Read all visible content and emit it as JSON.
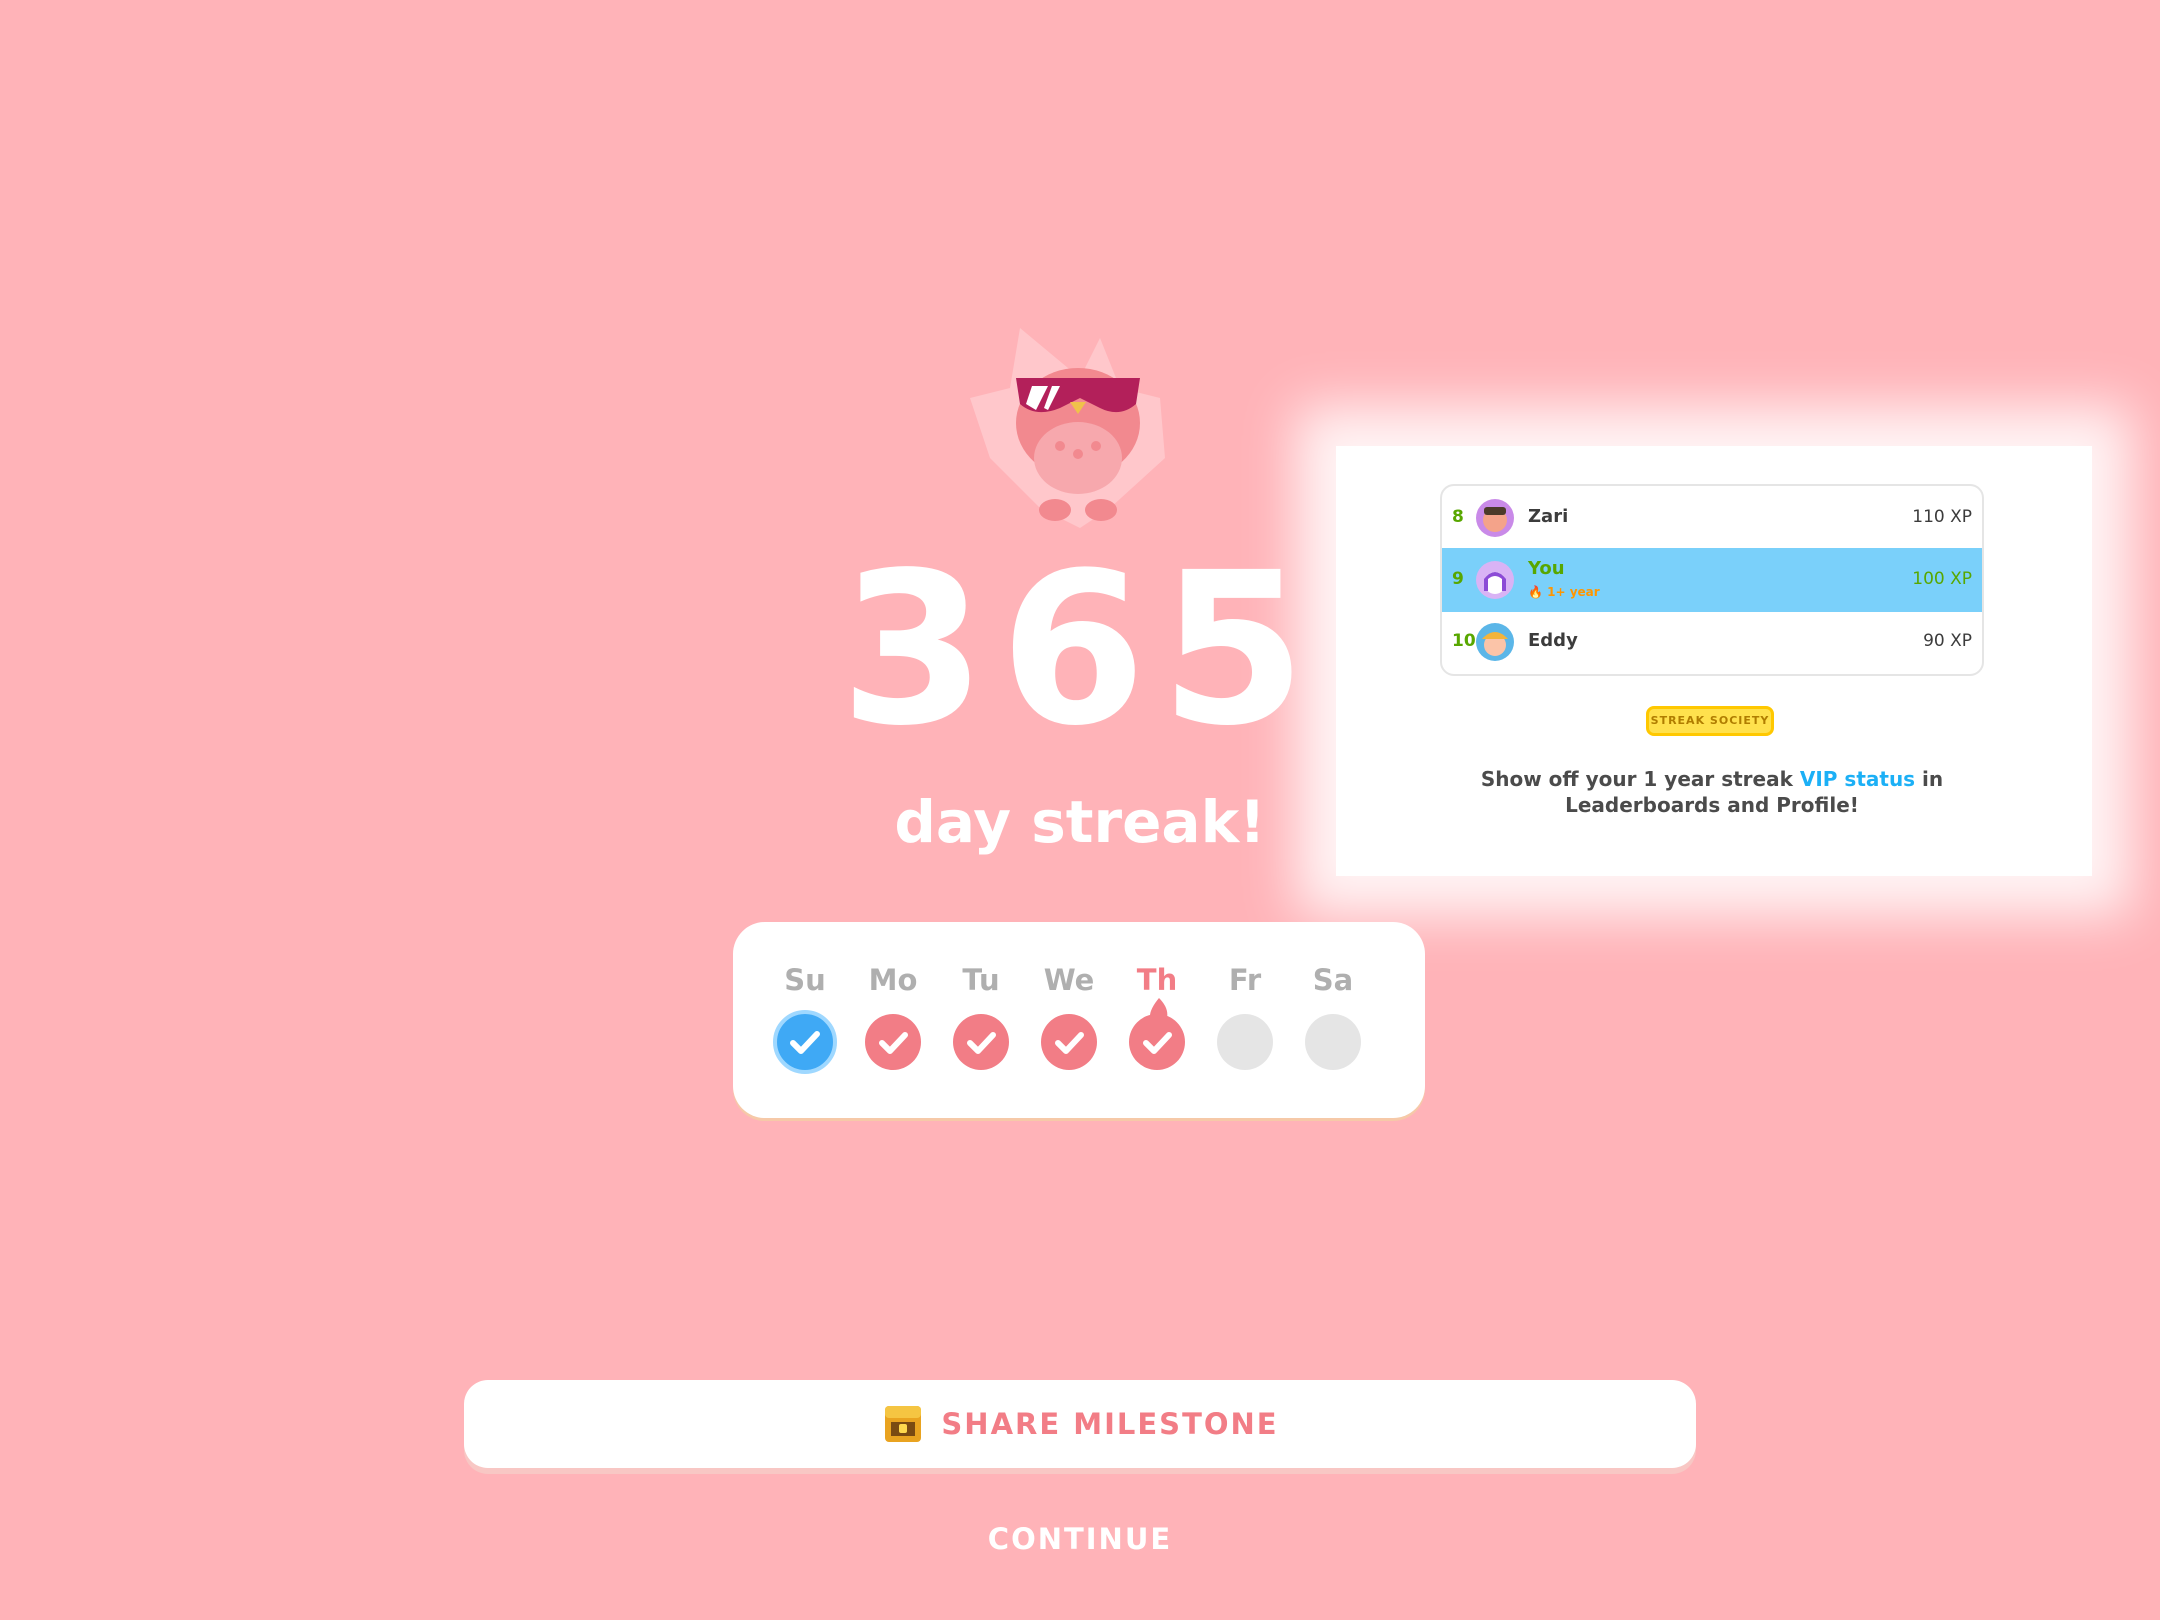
{
  "streak": {
    "count": "365",
    "label": "day streak!"
  },
  "week": {
    "days": [
      {
        "label": "Su",
        "status": "freeze"
      },
      {
        "label": "Mo",
        "status": "done"
      },
      {
        "label": "Tu",
        "status": "done"
      },
      {
        "label": "We",
        "status": "done"
      },
      {
        "label": "Th",
        "status": "today-done"
      },
      {
        "label": "Fr",
        "status": "empty"
      },
      {
        "label": "Sa",
        "status": "empty"
      }
    ]
  },
  "vip_card": {
    "leaderboard": [
      {
        "rank": "8",
        "name": "Zari",
        "xp": "110 XP"
      },
      {
        "rank": "9",
        "name": "You",
        "badge": "1+ year",
        "xp": "100 XP"
      },
      {
        "rank": "10",
        "name": "Eddy",
        "xp": "90 XP"
      }
    ],
    "badge_label": "STREAK SOCIETY",
    "description_part1": "Show off your 1 year streak ",
    "description_highlight": "VIP status",
    "description_part2": " in Leaderboards and Profile!"
  },
  "buttons": {
    "share_label": "SHARE MILESTONE",
    "continue_label": "CONTINUE"
  },
  "icons": {
    "mascot": "owl-sunglasses-icon",
    "check": "check-icon",
    "chest": "treasure-chest-icon",
    "flame": "flame-icon"
  },
  "colors": {
    "background": "#ffb3b8",
    "accent": "#f27d86",
    "freeze": "#3fa9f5",
    "highlight_row": "#7ad0fa",
    "vip_link": "#1cb0f6",
    "rank_green": "#58a700"
  }
}
